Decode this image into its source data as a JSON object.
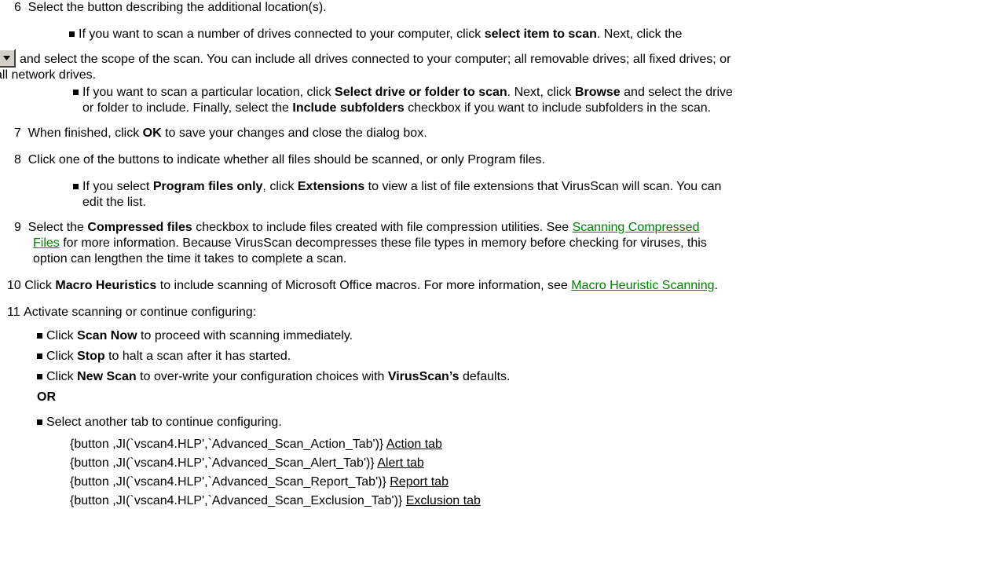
{
  "step6": {
    "num": "6",
    "text": "Select the button describing the additional location(s).",
    "b1_pre": "If you want to scan a number of drives connected to your computer, click ",
    "b1_bold": "select item to scan",
    "b1_post": ". Next, click the",
    "b1_cont1": "and select the scope of the scan. You can include all drives connected to your computer; all removable drives; all fixed drives; or",
    "b1_cont2": "all network drives.",
    "b2_pre": "If you want to scan a particular location, click ",
    "b2_bold1": "Select drive or folder to scan",
    "b2_mid": ". Next, click ",
    "b2_bold2": "Browse",
    "b2_post": " and select the drive",
    "b2_l2_pre": "or folder to include. Finally, select the ",
    "b2_l2_bold": "Include subfolders",
    "b2_l2_post": " checkbox if you want to include subfolders in the scan."
  },
  "step7": {
    "num": "7",
    "pre": "When finished, click ",
    "bold": "OK",
    "post": " to save your changes and close the dialog box."
  },
  "step8": {
    "num": "8",
    "text": "Click one of the buttons to indicate whether all files should be scanned, or only Program files.",
    "b_pre": "If you select ",
    "b_bold1": "Program files only",
    "b_mid": ", click ",
    "b_bold2": "Extensions",
    "b_post": " to view a list of file extensions that VirusScan will scan. You can",
    "b_l2": "edit the list."
  },
  "step9": {
    "num": "9",
    "pre": "Select the ",
    "bold": "Compressed files",
    "post": " checkbox to include files created with file compression utilities. See ",
    "link1": "Scanning Compressed ",
    "link2": "Files",
    "l2_post": " for more information. Because VirusScan decompresses these file types in memory before checking for viruses, this",
    "l3": "option can lengthen the time it takes to complete a scan."
  },
  "step10": {
    "num": "10",
    "pre": "Click ",
    "bold": "Macro Heuristics",
    "post": " to include scanning of Microsoft Office macros. For more information, see ",
    "link": "Macro Heuristic Scanning",
    "end": "."
  },
  "step11": {
    "num": "11",
    "text": "Activate scanning or continue configuring:",
    "b1_pre": "Click ",
    "b1_bold": "Scan Now",
    "b1_post": " to proceed with scanning immediately.",
    "b2_pre": "Click ",
    "b2_bold": "Stop",
    "b2_post": " to halt a scan after it has started.",
    "b3_pre": "Click ",
    "b3_bold": "New Scan",
    "b3_mid": " to over-write your configuration choices with ",
    "b3_bold2": "VirusScan’s",
    "b3_post": " defaults.",
    "or": "OR",
    "b4": "Select another tab to continue configuring."
  },
  "macros": [
    {
      "code": "{button ,JI(`vscan4.HLP',`Advanced_Scan_Action_Tab')}",
      "label": "Action tab"
    },
    {
      "code": "{button ,JI(`vscan4.HLP',`Advanced_Scan_Alert_Tab')}",
      "label": "Alert tab"
    },
    {
      "code": "{button ,JI(`vscan4.HLP',`Advanced_Scan_Report_Tab')}",
      "label": "Report tab"
    },
    {
      "code": "{button ,JI(`vscan4.HLP',`Advanced_Scan_Exclusion_Tab')}",
      "label": "Exclusion tab"
    }
  ],
  "icons": {
    "dropdown": "dropdown-arrow-icon"
  },
  "colors": {
    "link": "#008000",
    "text": "#000000"
  }
}
